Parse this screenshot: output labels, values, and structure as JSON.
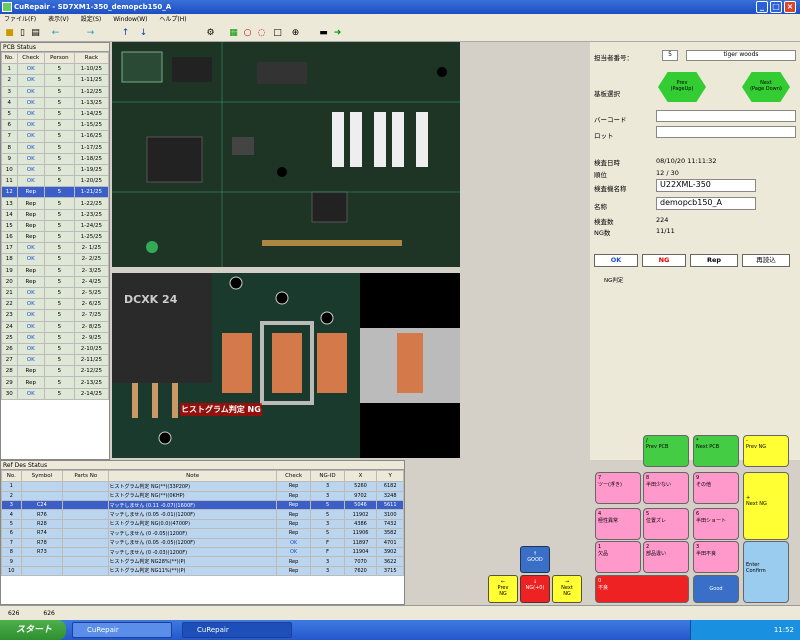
{
  "window": {
    "title": "CuRepair - SD7XM1-350_demopcb150_A"
  },
  "menu": [
    "ファイル(F)",
    "表示(V)",
    "設定(S)",
    "Window(W)",
    "ヘルプ(H)"
  ],
  "pcb_status": {
    "title": "PCB Status",
    "columns": [
      "No.",
      "Check",
      "Person",
      "Rack"
    ],
    "rows": [
      [
        "1",
        "OK",
        "5",
        "1-10/25"
      ],
      [
        "2",
        "OK",
        "5",
        "1-11/25"
      ],
      [
        "3",
        "OK",
        "5",
        "1-12/25"
      ],
      [
        "4",
        "OK",
        "5",
        "1-13/25"
      ],
      [
        "5",
        "OK",
        "5",
        "1-14/25"
      ],
      [
        "6",
        "OK",
        "5",
        "1-15/25"
      ],
      [
        "7",
        "OK",
        "5",
        "1-16/25"
      ],
      [
        "8",
        "OK",
        "5",
        "1-17/25"
      ],
      [
        "9",
        "OK",
        "5",
        "1-18/25"
      ],
      [
        "10",
        "OK",
        "5",
        "1-19/25"
      ],
      [
        "11",
        "OK",
        "5",
        "1-20/25"
      ],
      [
        "12",
        "Rep",
        "5",
        "1-21/25"
      ],
      [
        "13",
        "Rep",
        "5",
        "1-22/25"
      ],
      [
        "14",
        "Rep",
        "5",
        "1-23/25"
      ],
      [
        "15",
        "Rep",
        "5",
        "1-24/25"
      ],
      [
        "16",
        "Rep",
        "5",
        "1-25/25"
      ],
      [
        "17",
        "OK",
        "5",
        "2- 1/25"
      ],
      [
        "18",
        "OK",
        "5",
        "2- 2/25"
      ],
      [
        "19",
        "Rep",
        "5",
        "2- 3/25"
      ],
      [
        "20",
        "Rep",
        "5",
        "2- 4/25"
      ],
      [
        "21",
        "OK",
        "5",
        "2- 5/25"
      ],
      [
        "22",
        "OK",
        "5",
        "2- 6/25"
      ],
      [
        "23",
        "OK",
        "5",
        "2- 7/25"
      ],
      [
        "24",
        "OK",
        "5",
        "2- 8/25"
      ],
      [
        "25",
        "OK",
        "5",
        "2- 9/25"
      ],
      [
        "26",
        "OK",
        "5",
        "2-10/25"
      ],
      [
        "27",
        "OK",
        "5",
        "2-11/25"
      ],
      [
        "28",
        "Rep",
        "5",
        "2-12/25"
      ],
      [
        "29",
        "Rep",
        "5",
        "2-13/25"
      ],
      [
        "30",
        "OK",
        "5",
        "2-14/25"
      ]
    ],
    "selected_row": 12
  },
  "image_labels": {
    "ic_marking": "DCXK 24",
    "ng_tag": "ヒストグラム判定 NG"
  },
  "right": {
    "inspector_label": "担当者番号：",
    "inspector_no": "5",
    "inspector_name": "tiger woods",
    "board_select_label": "基板選択",
    "prev": "Prev\n(PageUp)",
    "next": "Next\n(Page Down)",
    "barcode_label": "バーコード",
    "lot_label": "ロット",
    "date_label": "検査日時",
    "date_value": "08/10/20 11:11:32",
    "order_label": "順位",
    "order_value": "12 / 30",
    "machine_label": "検査機名称",
    "machine_value": "U22XML-350",
    "name_label": "名称",
    "name_value": "demopcb150_A",
    "count_label": "検査数",
    "count_value": "224",
    "ng_label": "NG数",
    "ng_value": "11/11",
    "btn_ok": "OK",
    "btn_ng": "NG",
    "btn_rep": "Rep",
    "btn_reload": "再読込",
    "ng_judge": "NG判定"
  },
  "ref_status": {
    "title": "Ref Des Status",
    "columns": [
      "No.",
      "Symbol",
      "Parts No",
      "Note",
      "Check",
      "NG-ID",
      "X",
      "Y"
    ],
    "rows": [
      [
        "1",
        "",
        "",
        "ヒストグラム判定 NG(**)(33P20P)",
        "Rep",
        "3",
        "5260",
        "6182"
      ],
      [
        "2",
        "",
        "",
        "ヒストグラム判定 NG(**)(0KHP)",
        "Rep",
        "3",
        "9702",
        "3248"
      ],
      [
        "3",
        "C24",
        "",
        "マッチしません (0.11 -0.07)(1600F)",
        "Rep",
        "5",
        "5046",
        "5611"
      ],
      [
        "4",
        "R76",
        "",
        "マッチしません (0.05 -0.01)(1200F)",
        "Rep",
        "5",
        "11902",
        "3100"
      ],
      [
        "5",
        "R28",
        "",
        "ヒストグラム判定 NG(0.0)(4700P)",
        "Rep",
        "3",
        "4386",
        "7432"
      ],
      [
        "6",
        "R74",
        "",
        "マッチしません (0 -0.05)(1200F)",
        "Rep",
        "5",
        "11906",
        "3582"
      ],
      [
        "7",
        "R78",
        "",
        "マッチしません (0.05 -0.05)(1200F)",
        "OK",
        "F",
        "11897",
        "4701"
      ],
      [
        "8",
        "R73",
        "",
        "マッチしません (0 -0.03)(1200F)",
        "OK",
        "F",
        "11904",
        "3902"
      ],
      [
        "9",
        "",
        "",
        "ヒストグラム判定 NG28%(**)(P)",
        "Rep",
        "3",
        "7070",
        "3622"
      ],
      [
        "10",
        "",
        "",
        "ヒストグラム判定 NG11%(**)(P)",
        "Rep",
        "3",
        "7620",
        "3715"
      ]
    ],
    "selected_row": 3
  },
  "nav": {
    "good": "GOOD",
    "prev_ng": "Prev\nNG",
    "ng": "NG(+0)",
    "next_ng": "Next\nNG"
  },
  "keypad": {
    "prev_pcb": "Prev PCB",
    "next_pcb": "Next PCB",
    "prev_ng": "Prev NG",
    "next_ng": "Next NG",
    "k7": "ツー(浮き)",
    "k8": "半田少ない",
    "k9": "その他",
    "k4": "極性異常",
    "k5": "位置ズレ",
    "k6": "半田ショート",
    "k1": "欠品",
    "k2": "部品違い",
    "k3": "半田不良",
    "k0": "不良",
    "good": "Good",
    "enter": "Enter\nConfirm"
  },
  "status": {
    "left": "626",
    "right": "626"
  },
  "taskbar": {
    "start": "スタート",
    "task1": "CuRepair",
    "task2": "CuRepair",
    "time": "11:52"
  }
}
